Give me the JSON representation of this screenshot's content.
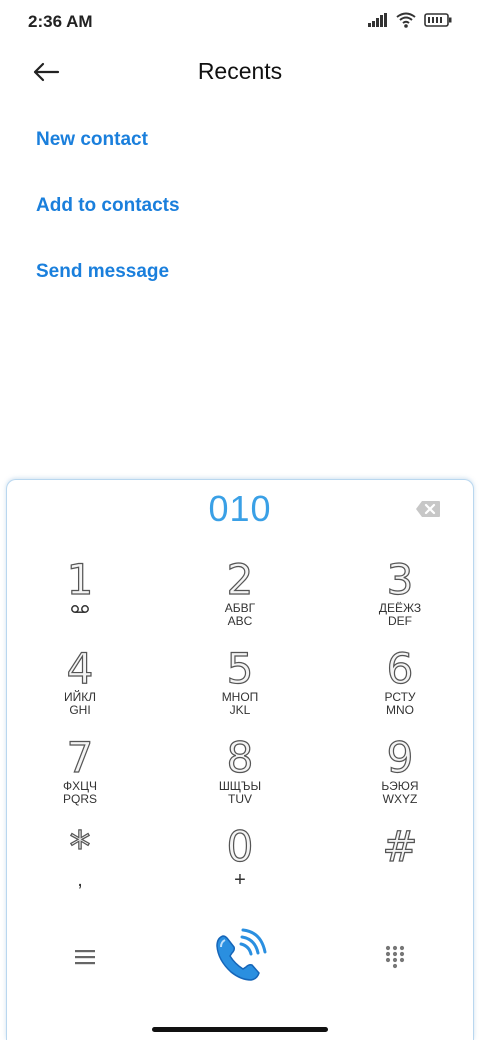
{
  "status_bar": {
    "time": "2:36 AM",
    "icons": [
      "signal-icon",
      "wifi-icon",
      "battery-icon"
    ]
  },
  "header": {
    "title": "Recents",
    "back_icon": "back-arrow-icon"
  },
  "actions": [
    {
      "label": "New contact"
    },
    {
      "label": "Add to contacts"
    },
    {
      "label": "Send message"
    }
  ],
  "dialpad": {
    "number": "010",
    "keys": [
      {
        "digit": "1",
        "sub": ""
      },
      {
        "digit": "2",
        "sub_cyr": "АБВГ",
        "sub_lat": "ABC"
      },
      {
        "digit": "3",
        "sub_cyr": "ДЕЁЖЗ",
        "sub_lat": "DEF"
      },
      {
        "digit": "4",
        "sub_cyr": "ИЙКЛ",
        "sub_lat": "GHI"
      },
      {
        "digit": "5",
        "sub_cyr": "МНОП",
        "sub_lat": "JKL"
      },
      {
        "digit": "6",
        "sub_cyr": "РСТУ",
        "sub_lat": "MNO"
      },
      {
        "digit": "7",
        "sub_cyr": "ФХЦЧ",
        "sub_lat": "PQRS"
      },
      {
        "digit": "8",
        "sub_cyr": "ШЩЪЫ",
        "sub_lat": "TUV"
      },
      {
        "digit": "9",
        "sub_cyr": "ЬЭЮЯ",
        "sub_lat": "WXYZ"
      },
      {
        "digit": "*",
        "sub": ","
      },
      {
        "digit": "0",
        "sub": "+"
      },
      {
        "digit": "#",
        "sub": ""
      }
    ]
  },
  "colors": {
    "accent": "#1a7fdc",
    "dial_number": "#3aa0e6"
  }
}
